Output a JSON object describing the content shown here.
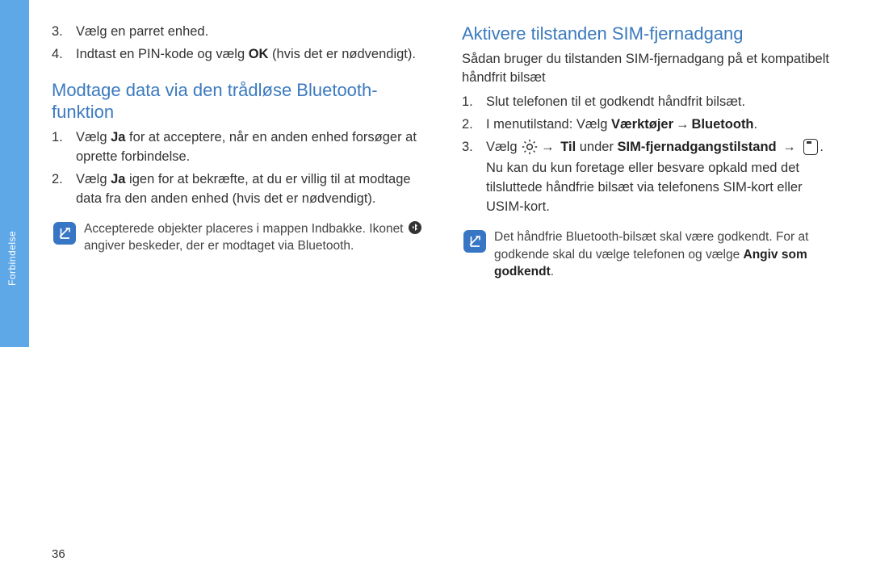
{
  "side_tab": {
    "label": "Forbindelse"
  },
  "left": {
    "list1": {
      "item3": {
        "num": "3.",
        "text": "Vælg en parret enhed."
      },
      "item4": {
        "num": "4.",
        "prefix": "Indtast en PIN-kode og vælg ",
        "bold": "OK",
        "suffix": " (hvis det er nødvendigt)."
      }
    },
    "heading": "Modtage data via den trådløse Bluetooth-funktion",
    "list2": {
      "item1": {
        "num": "1.",
        "prefix": "Vælg ",
        "bold": "Ja",
        "suffix": " for at acceptere, når en anden enhed forsøger at oprette forbindelse."
      },
      "item2": {
        "num": "2.",
        "prefix": "Vælg ",
        "bold": "Ja",
        "suffix": " igen for at bekræfte, at du er villig til at modtage data fra den anden enhed (hvis det er nødvendigt)."
      }
    },
    "note": {
      "pre": "Accepterede objekter placeres i mappen Indbakke. Ikonet ",
      "post": " angiver beskeder, der er modtaget via Bluetooth."
    }
  },
  "right": {
    "heading": "Aktivere tilstanden SIM-fjernadgang",
    "intro": "Sådan bruger du tilstanden SIM-fjernadgang på et kompatibelt håndfrit bilsæt",
    "list": {
      "item1": {
        "num": "1.",
        "text": "Slut telefonen til et godkendt håndfrit bilsæt."
      },
      "item2": {
        "num": "2.",
        "prefix": "I menutilstand: Vælg ",
        "bold1": "Værktøjer",
        "arrow1": "→",
        "bold2": "Bluetooth",
        "suffix": "."
      },
      "item3": {
        "num": "3.",
        "prefix": "Vælg ",
        "arrow1": "→",
        "bold_til": "Til",
        "mid": " under ",
        "bold_sim": "SIM-fjernadgangstilstand",
        "arrow2": "→",
        "suffix": ".",
        "after": "Nu kan du kun foretage eller besvare opkald med det tilsluttede håndfrie bilsæt via telefonens SIM-kort eller USIM-kort."
      }
    },
    "note": {
      "pre": "Det håndfrie Bluetooth-bilsæt skal være godkendt. For at godkende skal du vælge telefonen og vælge ",
      "bold": "Angiv som godkendt",
      "suffix": "."
    }
  },
  "page_number": "36"
}
